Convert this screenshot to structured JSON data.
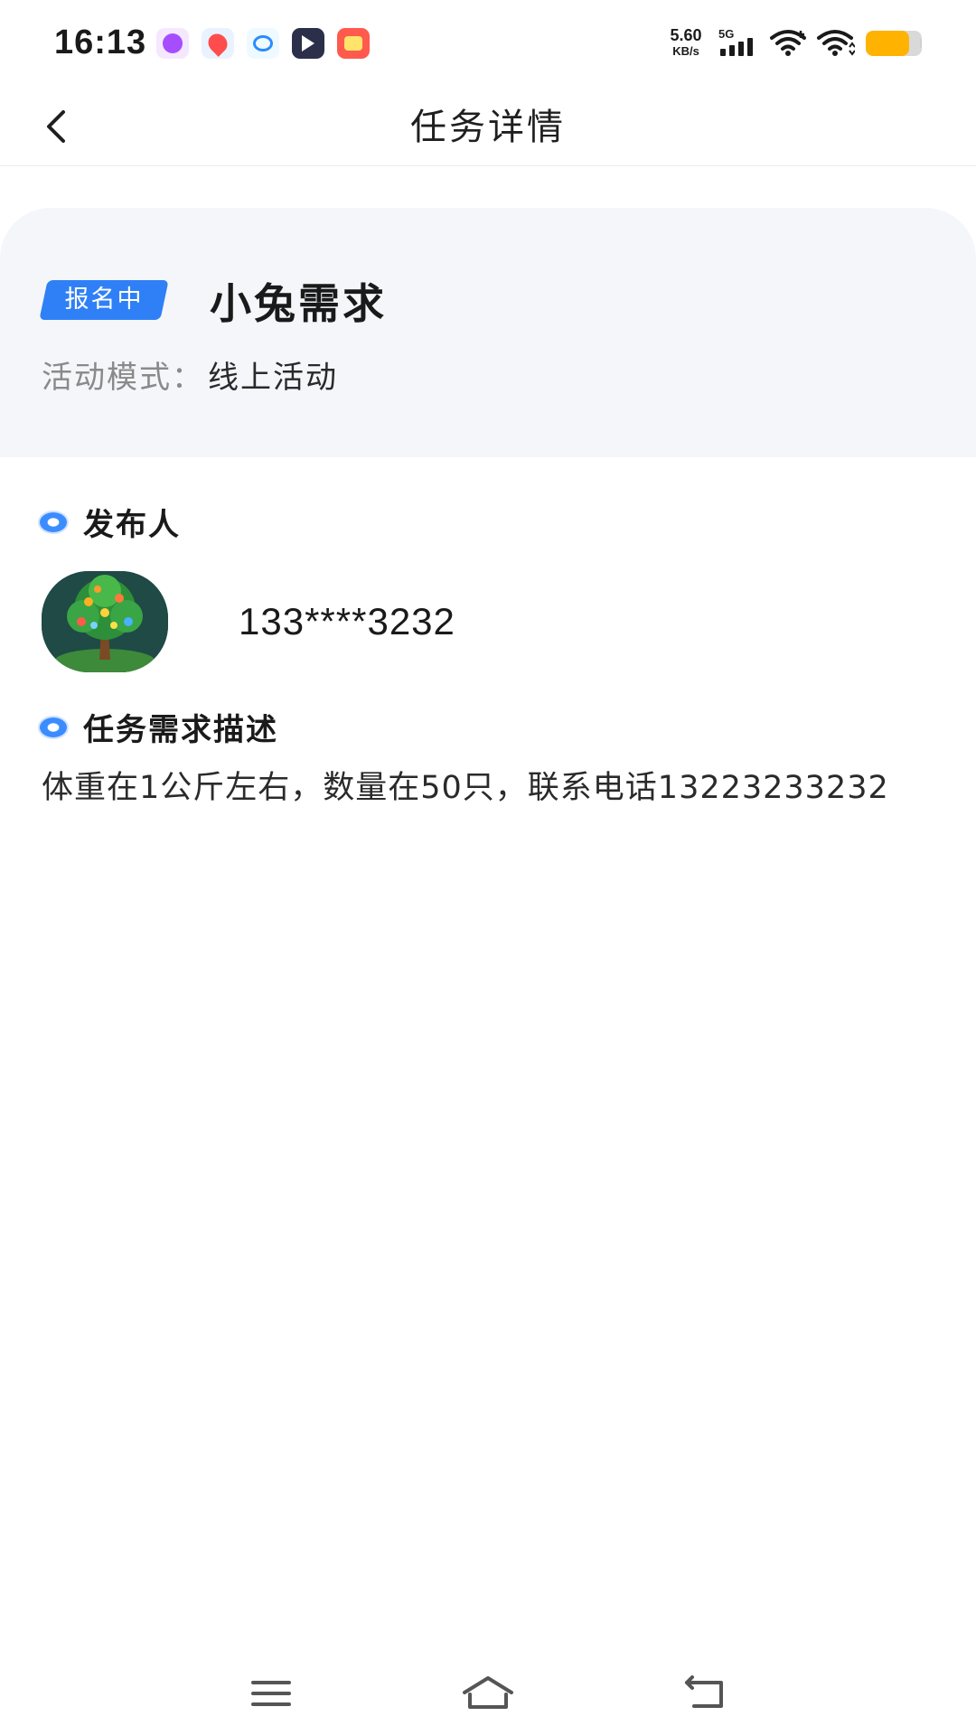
{
  "status_bar": {
    "time": "16:13",
    "net_speed_value": "5.60",
    "net_speed_unit": "KB/s",
    "network_type": "5G",
    "battery_color": "#ffb300",
    "battery_level": 0.78,
    "notification_icons": [
      "assistant-app-icon",
      "map-pin-app-icon",
      "chat-app-icon",
      "video-player-app-icon",
      "game-app-icon"
    ]
  },
  "nav": {
    "title": "任务详情",
    "back_icon": "chevron-left-icon"
  },
  "task": {
    "status_tag": "报名中",
    "status_color": "#2f80f7",
    "title": "小兔需求",
    "mode_label": "活动模式：",
    "mode_value": "线上活动"
  },
  "publisher_section": {
    "title": "发布人",
    "phone": "133****3232",
    "avatar_icon": "tree-avatar"
  },
  "description_section": {
    "title": "任务需求描述",
    "text": "体重在1公斤左右，数量在50只，联系电话13223233232"
  },
  "system_nav": {
    "icons": [
      "menu-icon",
      "home-icon",
      "back-icon"
    ]
  }
}
